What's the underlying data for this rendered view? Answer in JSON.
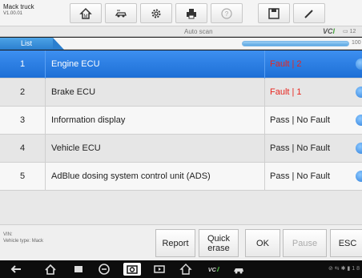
{
  "app": {
    "title": "Mack truck",
    "version": "V1.00.01"
  },
  "toolbar": {
    "icons": [
      "home-icon",
      "vehicle-swap-icon",
      "settings-gear-icon",
      "print-icon",
      "help-icon",
      "save-icon",
      "edit-pen-icon"
    ]
  },
  "status": {
    "center_text": "Auto scan",
    "vci_prefix": "VC",
    "vci_suffix": "I",
    "battery_text": "12"
  },
  "tab": {
    "label": "List",
    "progress_label": "100"
  },
  "rows": [
    {
      "num": "1",
      "name": "Engine ECU",
      "status": "Fault | 2",
      "fault": true,
      "selected": true
    },
    {
      "num": "2",
      "name": "Brake ECU",
      "status": "Fault | 1",
      "fault": true,
      "selected": false
    },
    {
      "num": "3",
      "name": "Information display",
      "status": "Pass | No Fault",
      "fault": false,
      "selected": false
    },
    {
      "num": "4",
      "name": "Vehicle ECU",
      "status": "Pass | No Fault",
      "fault": false,
      "selected": false
    },
    {
      "num": "5",
      "name": "AdBlue dosing system control unit (ADS)",
      "status": "Pass | No Fault",
      "fault": false,
      "selected": false
    }
  ],
  "footer": {
    "vin_label": "VIN:",
    "vehicle_type": "Vehicle type: Mack",
    "buttons": {
      "report": "Report",
      "quick_erase_line1": "Quick",
      "quick_erase_line2": "erase",
      "ok": "OK",
      "pause": "Pause",
      "esc": "ESC"
    }
  },
  "navbar": {
    "status_text": "⊘ ⇆ ✱ ▮ 1 8"
  },
  "colors": {
    "accent": "#2b7fcf",
    "fault": "#e8261f",
    "selected_row": "#1d6fd6"
  }
}
